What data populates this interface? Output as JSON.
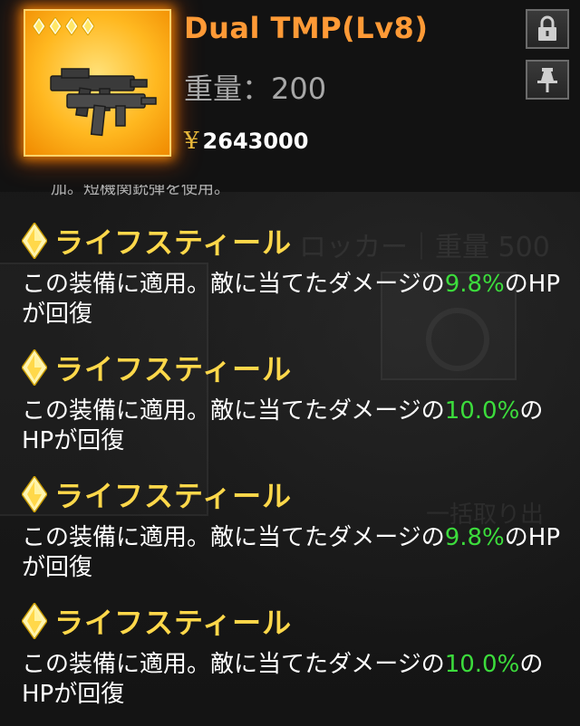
{
  "item": {
    "name": "Dual TMP(Lv8)",
    "weight_label": "重量",
    "weight_sep": "：",
    "weight_value": "200",
    "currency_symbol": "¥",
    "price": "2643000",
    "rarity_stars": 4,
    "card_icon": "submachine-gun-pair-icon"
  },
  "actions": {
    "lock_icon": "lock-icon",
    "pin_icon": "pin-icon"
  },
  "partial_line": "加。短機関銃弾を使用。",
  "background_ghost_text": "ロッカー｜重量 500",
  "background_ghost_text2": "一括取り出",
  "skills": [
    {
      "name": "ライフスティール",
      "desc_before": "この装備に適用。敵に当てたダメージの",
      "value": "9.8%",
      "desc_after": "のHPが回復"
    },
    {
      "name": "ライフスティール",
      "desc_before": "この装備に適用。敵に当てたダメージの",
      "value": "10.0%",
      "desc_after": "のHPが回復"
    },
    {
      "name": "ライフスティール",
      "desc_before": "この装備に適用。敵に当てたダメージの",
      "value": "9.8%",
      "desc_after": "のHPが回復"
    },
    {
      "name": "ライフスティール",
      "desc_before": "この装備に適用。敵に当てたダメージの",
      "value": "10.0%",
      "desc_after": "のHPが回復"
    }
  ],
  "colors": {
    "title": "#ff9a36",
    "skill_name": "#ffd84a",
    "value_green": "#3cdc3c",
    "card_glow": "#ff8c00"
  }
}
